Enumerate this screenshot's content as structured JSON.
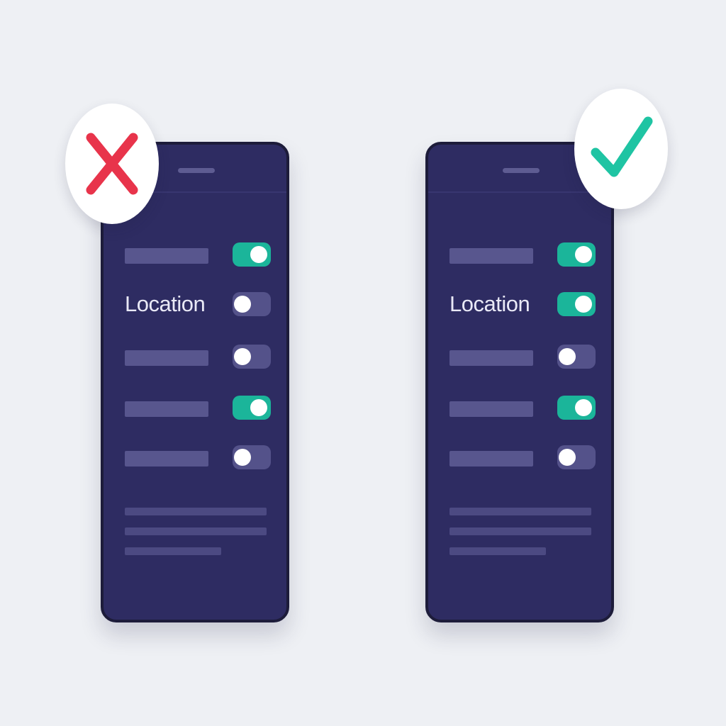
{
  "colors": {
    "background": "#eef0f4",
    "phone_body": "#2e2c62",
    "toggle_on": "#1bb59a",
    "toggle_off": "#54528a",
    "wrong_mark": "#e8344b",
    "right_mark": "#1fc4a3"
  },
  "badges": {
    "left": {
      "icon": "cross-icon",
      "status": "incorrect"
    },
    "right": {
      "icon": "check-icon",
      "status": "correct"
    }
  },
  "phones": {
    "left": {
      "location_label": "Location",
      "toggles": [
        {
          "row": 1,
          "state": "on"
        },
        {
          "row": 2,
          "label": "Location",
          "state": "off"
        },
        {
          "row": 3,
          "state": "off"
        },
        {
          "row": 4,
          "state": "on"
        },
        {
          "row": 5,
          "state": "off"
        }
      ]
    },
    "right": {
      "location_label": "Location",
      "toggles": [
        {
          "row": 1,
          "state": "on"
        },
        {
          "row": 2,
          "label": "Location",
          "state": "on"
        },
        {
          "row": 3,
          "state": "off"
        },
        {
          "row": 4,
          "state": "on"
        },
        {
          "row": 5,
          "state": "off"
        }
      ]
    }
  }
}
